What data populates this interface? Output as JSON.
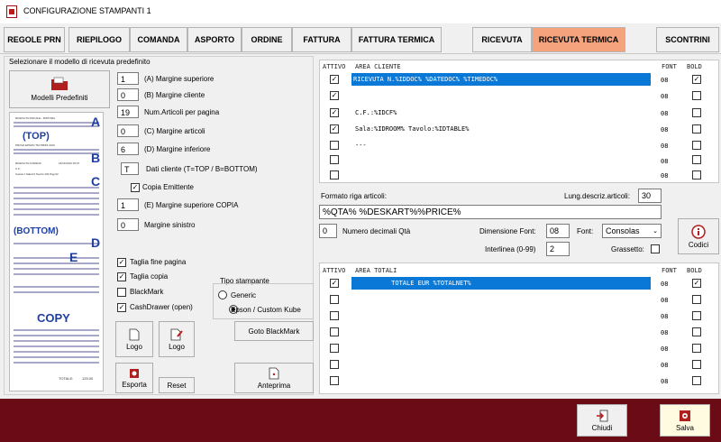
{
  "window": {
    "title": "CONFIGURAZIONE STAMPANTI 1"
  },
  "tabs": [
    {
      "label": "REGOLE PRN"
    },
    {
      "label": "RIEPILOGO"
    },
    {
      "label": "COMANDA"
    },
    {
      "label": "ASPORTO"
    },
    {
      "label": "ORDINE"
    },
    {
      "label": "FATTURA"
    },
    {
      "label": "FATTURA TERMICA"
    },
    {
      "label": "RICEVUTA"
    },
    {
      "label": "RICEVUTA TERMICA"
    },
    {
      "label": "SCONTRINI"
    }
  ],
  "left": {
    "group_title": "Selezionare il modello di ricevuta predefinito",
    "models_button": "Modelli Predefiniti",
    "fields": [
      {
        "value": "1",
        "label": "(A) Margine superiore"
      },
      {
        "value": "0",
        "label": "(B) Margine cliente"
      },
      {
        "value": "19",
        "label": "Num.Articoli per pagina"
      },
      {
        "value": "0",
        "label": "(C) Margine articoli"
      },
      {
        "value": "6",
        "label": "(D) Margine inferiore"
      },
      {
        "value": "T",
        "label": "Dati cliente (T=TOP / B=BOTTOM)"
      }
    ],
    "copia_emittente": {
      "label": "Copia Emittente",
      "checked": true
    },
    "fields2": [
      {
        "value": "1",
        "label": "(E) Margine superiore COPIA"
      },
      {
        "value": "0",
        "label": "Margine sinistro"
      }
    ],
    "checks": [
      {
        "label": "Taglia fine pagina",
        "checked": true
      },
      {
        "label": "Taglia copia",
        "checked": true
      },
      {
        "label": "BlackMark",
        "checked": false
      },
      {
        "label": "CashDrawer (open)",
        "checked": true
      }
    ],
    "printer_type": {
      "title": "Tipo stampante",
      "options": [
        {
          "label": "Generic",
          "selected": false
        },
        {
          "label": "Epson / Custom Kube",
          "selected": true
        }
      ]
    },
    "buttons": {
      "logo1": "Logo",
      "logo2": "Logo",
      "goto_blackmark": "Goto BlackMark",
      "esporta": "Esporta",
      "reset": "Reset",
      "anteprima": "Anteprima"
    },
    "preview_letters": [
      "A",
      "B",
      "C",
      "D",
      "E"
    ],
    "preview_tags": [
      "(TOP)",
      "(BOTTOM)",
      "COPY"
    ],
    "preview": {
      "header": "RICEVUTA FISCALE - RISTORA",
      "printer": "PROVA EPSON TM-T88FII 2016",
      "doc": "RICEVUTA N.000010",
      "date": "16/11/2016 15:07",
      "cf": "C.F.:",
      "sala": "Cassa:1 Sala:01 Tavolo:102 Pag.02",
      "items": [
        {
          "qty": "1",
          "name": "Insalata mista",
          "price": "6.50"
        },
        {
          "qty": "1",
          "name": "Chorra",
          "price": "7.70"
        },
        {
          "qty": "1",
          "name": "Patate fritte",
          "price": "6.70"
        },
        {
          "qty": "1",
          "name": "Broccoletti all'agro",
          "price": "9.50"
        },
        {
          "qty": "1",
          "name": "Melanzane grigliate",
          "price": "11.00"
        },
        {
          "qty": "1",
          "name": "Fiori di zucca",
          "price": "6.50"
        },
        {
          "qty": "1",
          "name": "Supplì",
          "price": "7.70"
        },
        {
          "qty": "1",
          "name": "Baccalà",
          "price": "8.00"
        }
      ],
      "total": "TOTALE:",
      "total_value": "125.00"
    }
  },
  "client_grid": {
    "headers": {
      "attivo": "ATTIVO",
      "area": "AREA CLIENTE",
      "font": "FONT",
      "bold": "BOLD"
    },
    "rows": [
      {
        "active": true,
        "text": "RICEVUTA N.%IDDOC% %DATEDOC% %TIMEDOC%",
        "font": "08",
        "bold": true,
        "selected": true
      },
      {
        "active": true,
        "text": "",
        "font": "08",
        "bold": false,
        "selected": false
      },
      {
        "active": true,
        "text": "C.F.:%IDCF%",
        "font": "08",
        "bold": false,
        "selected": false
      },
      {
        "active": true,
        "text": "Sala:%IDROOM% Tavolo:%IDTABLE%",
        "font": "08",
        "bold": false,
        "selected": false
      },
      {
        "active": false,
        "text": "---",
        "font": "08",
        "bold": false,
        "selected": false
      },
      {
        "active": false,
        "text": "",
        "font": "08",
        "bold": false,
        "selected": false
      },
      {
        "active": false,
        "text": "",
        "font": "08",
        "bold": false,
        "selected": false
      }
    ]
  },
  "articles": {
    "format_label": "Formato riga articoli:",
    "format_value": "%QTA% %DESKART%%PRICE%",
    "len_label": "Lung.descriz.articoli:",
    "len_value": "30",
    "decimals_value": "0",
    "decimals_label": "Numero decimali Qtà",
    "font_size_label": "Dimensione Font:",
    "font_size_value": "08",
    "font_label": "Font:",
    "font_value": "Consolas",
    "interlinea_label": "Interlinea (0-99)",
    "interlinea_value": "2",
    "grassetto_label": "Grassetto:",
    "codici_button": "Codici"
  },
  "totals_grid": {
    "headers": {
      "attivo": "ATTIVO",
      "area": "AREA TOTALI",
      "font": "FONT",
      "bold": "BOLD"
    },
    "rows": [
      {
        "active": true,
        "text": "          TOTALE EUR %TOTALNET%",
        "font": "08",
        "bold": true,
        "selected": true
      },
      {
        "active": false,
        "text": "",
        "font": "08",
        "bold": false,
        "selected": false
      },
      {
        "active": false,
        "text": "",
        "font": "08",
        "bold": false,
        "selected": false
      },
      {
        "active": false,
        "text": "",
        "font": "08",
        "bold": false,
        "selected": false
      },
      {
        "active": false,
        "text": "",
        "font": "08",
        "bold": false,
        "selected": false
      },
      {
        "active": false,
        "text": "",
        "font": "08",
        "bold": false,
        "selected": false
      },
      {
        "active": false,
        "text": "",
        "font": "08",
        "bold": false,
        "selected": false
      }
    ]
  },
  "footer": {
    "chiudi": "Chiudi",
    "salva": "Salva"
  },
  "colors": {
    "accent_tab": "#f5a37c",
    "selection": "#0a78d7",
    "footer_bar": "#6b0b16"
  }
}
